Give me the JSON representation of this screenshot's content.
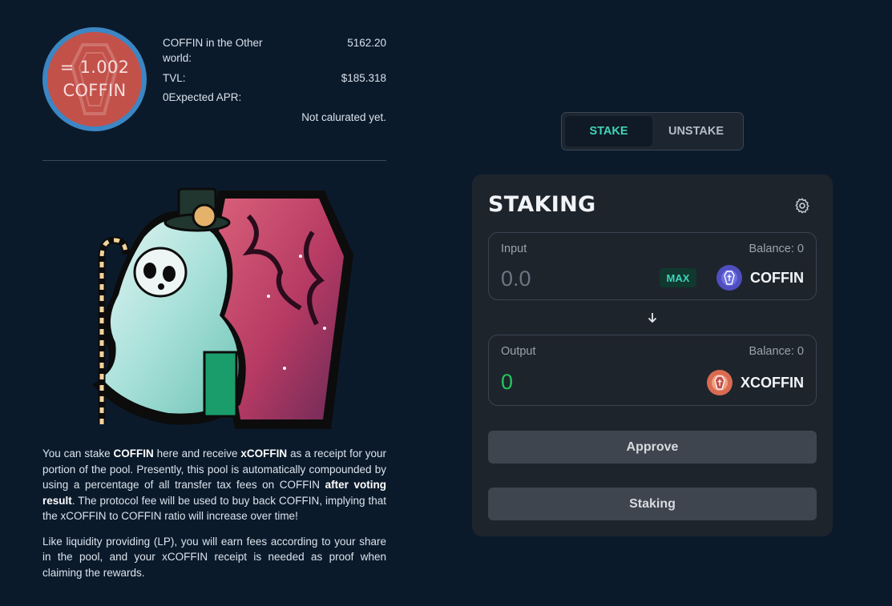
{
  "header": {
    "badge": {
      "ratio": "= 1.002",
      "symbol": "COFFIN",
      "ring_color": "#3c86c3",
      "fill_color": "#c2514a"
    },
    "stats": {
      "other_world_label": "COFFIN in the Other world:",
      "other_world_value": "5162.20",
      "tvl_label": "TVL:",
      "tvl_value": "$185.318",
      "apr_label": "0Expected APR:",
      "apr_note": "Not calurated yet."
    }
  },
  "artwork": {
    "icon": "ghost-coffin-illustration"
  },
  "description": {
    "p1": {
      "t1": "You can stake ",
      "b1": "COFFIN",
      "t2": " here and receive ",
      "b2": "xCOFFIN",
      "t3": " as a receipt for your portion of the pool. Presently, this pool is automatically compounded by using a percentage of all transfer tax fees on COFFIN ",
      "b3": "after voting result",
      "t4": ". The protocol fee will be used to buy back COFFIN, implying that the xCOFFIN to COFFIN ratio will increase over time!"
    },
    "p2": "Like liquidity providing (LP), you will earn fees according to your share in the pool, and your xCOFFIN receipt is needed as proof when claiming the rewards."
  },
  "toggle": {
    "stake_label": "STAKE",
    "unstake_label": "UNSTAKE",
    "active": "STAKE",
    "accent": "#3fd3b6"
  },
  "panel": {
    "title": "STAKING",
    "settings_icon": "gear-icon",
    "input": {
      "label": "Input",
      "balance": "Balance: 0",
      "placeholder": "0.0",
      "max_label": "MAX",
      "token": "COFFIN",
      "token_icon": "coffin-token-icon"
    },
    "arrow_icon": "arrow-down-icon",
    "output": {
      "label": "Output",
      "balance": "Balance: 0",
      "amount": "0",
      "token": "XCOFFIN",
      "token_icon": "xcoffin-token-icon"
    },
    "approve_label": "Approve",
    "staking_label": "Staking"
  }
}
